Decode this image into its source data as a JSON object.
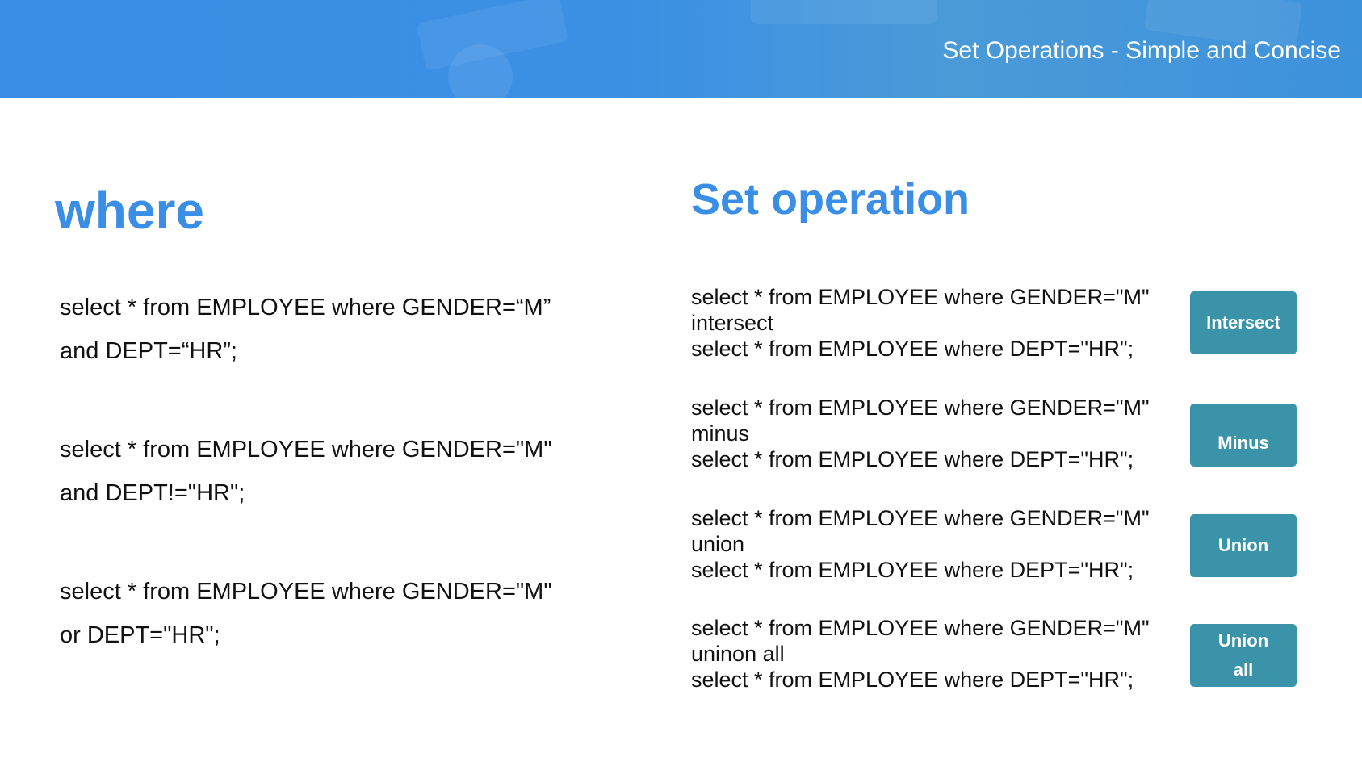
{
  "header": {
    "title": "Set Operations - Simple and Concise"
  },
  "where_section": {
    "heading": "where",
    "queries": [
      {
        "line1": "select * from EMPLOYEE where GENDER=“M”",
        "line2": "and DEPT=“HR”;"
      },
      {
        "line1": "select * from EMPLOYEE where GENDER=\"M\"",
        "line2": "and DEPT!=\"HR\";"
      },
      {
        "line1": "select * from EMPLOYEE where GENDER=\"M\"",
        "line2": "or DEPT=\"HR\";"
      }
    ]
  },
  "setop_section": {
    "heading": "Set operation",
    "operations": [
      {
        "line1": "select * from EMPLOYEE where GENDER=\"M\"",
        "keyword": "intersect",
        "line2": "select * from EMPLOYEE where DEPT=\"HR\";",
        "button_line1": "Intersect",
        "button_line2": ""
      },
      {
        "line1": "select * from EMPLOYEE where GENDER=\"M\"",
        "keyword": "minus",
        "line2": "select * from EMPLOYEE where DEPT=\"HR\";",
        "button_line1": "Minus",
        "button_line2": ""
      },
      {
        "line1": "select * from EMPLOYEE where GENDER=\"M\"",
        "keyword": "union",
        "line2": "select * from EMPLOYEE where DEPT=\"HR\";",
        "button_line1": "Union",
        "button_line2": ""
      },
      {
        "line1": "select * from EMPLOYEE where GENDER=\"M\"",
        "keyword": "uninon all",
        "line2": "select * from EMPLOYEE where DEPT=\"HR\";",
        "button_line1": "Union",
        "button_line2": "all"
      }
    ]
  },
  "colors": {
    "accent_blue": "#3a8ee6",
    "button_teal": "#3a93a8",
    "text": "#111111"
  }
}
